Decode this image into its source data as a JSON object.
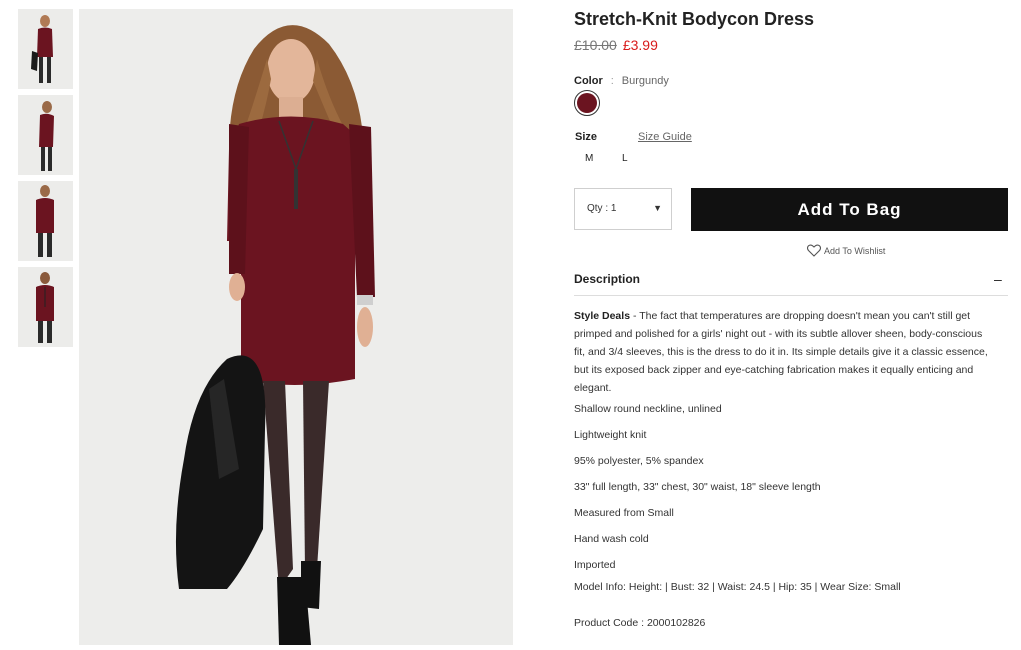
{
  "product": {
    "title": "Stretch-Knit Bodycon Dress",
    "old_price": "£10.00",
    "new_price": "£3.99"
  },
  "color": {
    "label": "Color",
    "separator": ":",
    "value": "Burgundy",
    "swatch_hex": "#6b1420"
  },
  "size": {
    "label": "Size",
    "guide_label": "Size Guide",
    "options": [
      "M",
      "L"
    ]
  },
  "qty": {
    "label": "Qty : 1",
    "arrow": "▼"
  },
  "actions": {
    "add_to_bag": "Add To Bag",
    "wishlist": "Add To Wishlist"
  },
  "description": {
    "heading": "Description",
    "toggle": "–",
    "style_deals_label": "Style Deals",
    "style_deals_text": " - The fact that temperatures are dropping doesn't mean you can't still get primped and polished for a girls' night out - with its subtle allover sheen, body-conscious fit, and 3/4 sleeves, this is the dress to do it in. Its simple details give it a classic essence, but its exposed back zipper and eye-catching fabrication makes it equally enticing and elegant.",
    "specs": [
      "Shallow round neckline, unlined",
      "Lightweight knit",
      "95% polyester, 5% spandex",
      "33\" full length, 33\" chest, 30\" waist, 18\" sleeve length",
      "Measured from Small",
      "Hand wash cold",
      "Imported",
      "Model Info: Height: | Bust: 32 | Waist: 24.5 | Hip: 35 | Wear Size: Small"
    ],
    "product_code": "Product Code : 2000102826"
  },
  "colors": {
    "accent_sale": "#d81b1b",
    "button_bg": "#111111",
    "dress": "#6b1420"
  }
}
